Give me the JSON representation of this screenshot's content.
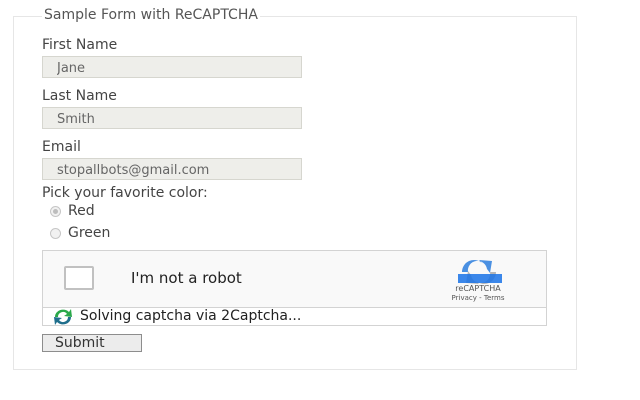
{
  "form": {
    "legend": "Sample Form with ReCAPTCHA",
    "first_name": {
      "label": "First Name",
      "value": "Jane"
    },
    "last_name": {
      "label": "Last Name",
      "value": "Smith"
    },
    "email": {
      "label": "Email",
      "value": "stopallbots@gmail.com"
    },
    "color_question": "Pick your favorite color:",
    "color_options": [
      {
        "label": "Red",
        "checked": true
      },
      {
        "label": "Green",
        "checked": false
      }
    ],
    "submit_label": "Submit"
  },
  "recaptcha": {
    "checkbox_label": "I'm not a robot",
    "brand": "reCAPTCHA",
    "links": "Privacy - Terms",
    "logo_colors": [
      "#4a90e2",
      "#1a73e8",
      "#b5b5b5"
    ]
  },
  "solver": {
    "status_text": "Solving captcha via 2Captcha...",
    "icon": "refresh-arrows-icon",
    "icon_colors": [
      "#2aa84a",
      "#1f6e8c"
    ]
  }
}
